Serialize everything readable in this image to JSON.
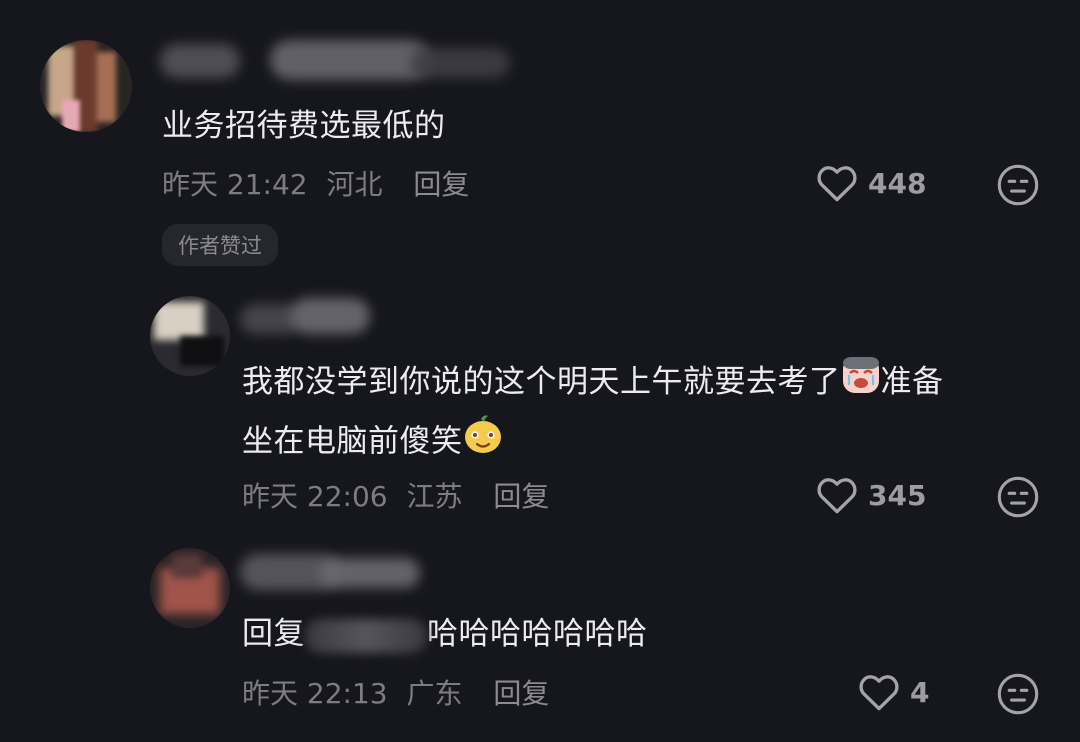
{
  "comments": [
    {
      "text": "业务招待费选最低的",
      "time": "昨天 21:42",
      "location": "河北",
      "reply_label": "回复",
      "likes": "448",
      "badge": "作者赞过"
    },
    {
      "text_line1": "我都没学到你说的这个明天上午就要去考了",
      "text_line1_tail": "准备",
      "text_line2": "坐在电脑前傻笑",
      "time": "昨天 22:06",
      "location": "江苏",
      "reply_label": "回复",
      "likes": "345",
      "emojis": [
        "crying-emoji",
        "smirk-emoji"
      ]
    },
    {
      "reply_prefix": "回复",
      "text": "哈哈哈哈哈哈哈",
      "time": "昨天 22:13",
      "location": "广东",
      "reply_label": "回复",
      "likes": "4"
    }
  ],
  "icons": {
    "like": "heart-outline-icon",
    "dislike": "meh-face-icon"
  },
  "colors": {
    "background": "#16161d",
    "text": "#ecebef",
    "meta": "#7d7c85"
  }
}
